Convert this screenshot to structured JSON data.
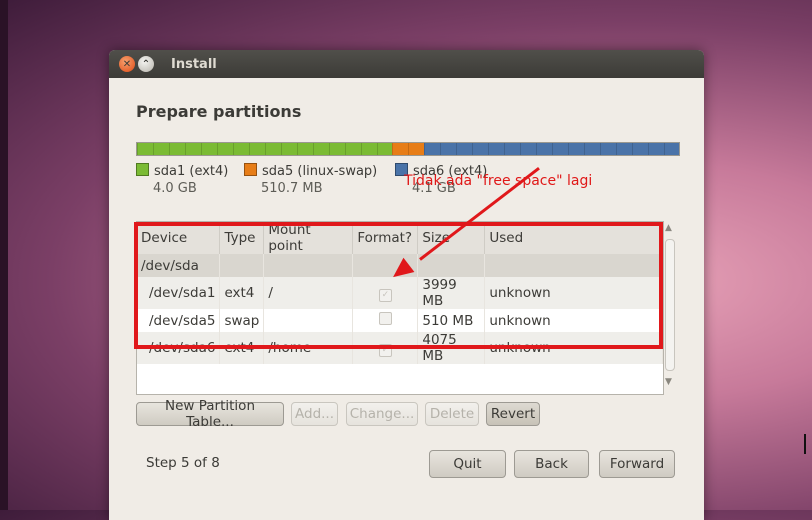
{
  "window": {
    "title": "Install"
  },
  "heading": "Prepare partitions",
  "partition_bar": {
    "segments": [
      {
        "name": "sda1",
        "fraction": 0.47,
        "color": "#7bbb34"
      },
      {
        "name": "sda5",
        "fraction": 0.06,
        "color": "#e77d17"
      },
      {
        "name": "sda6",
        "fraction": 0.47,
        "color": "#4a73a8"
      }
    ]
  },
  "legend": [
    {
      "label": "sda1 (ext4)",
      "size": "4.0 GB",
      "color": "#7bbb34"
    },
    {
      "label": "sda5 (linux-swap)",
      "size": "510.7 MB",
      "color": "#e77d17"
    },
    {
      "label": "sda6 (ext4)",
      "size": "4.1 GB",
      "color": "#4a73a8"
    }
  ],
  "annotation": "Tidak ada \"free space\" lagi",
  "table": {
    "columns": [
      "Device",
      "Type",
      "Mount point",
      "Format?",
      "Size",
      "Used"
    ],
    "device": "/dev/sda",
    "rows": [
      {
        "device": "/dev/sda1",
        "type": "ext4",
        "mount": "/",
        "format": true,
        "size": "3999 MB",
        "used": "unknown"
      },
      {
        "device": "/dev/sda5",
        "type": "swap",
        "mount": "",
        "format": false,
        "size": "510 MB",
        "used": "unknown"
      },
      {
        "device": "/dev/sda6",
        "type": "ext4",
        "mount": "/home",
        "format": true,
        "size": "4075 MB",
        "used": "unknown"
      }
    ]
  },
  "buttons": {
    "new_table": "New Partition Table...",
    "add": "Add...",
    "change": "Change...",
    "delete": "Delete",
    "revert": "Revert",
    "quit": "Quit",
    "back": "Back",
    "forward": "Forward"
  },
  "step": "Step 5 of 8"
}
